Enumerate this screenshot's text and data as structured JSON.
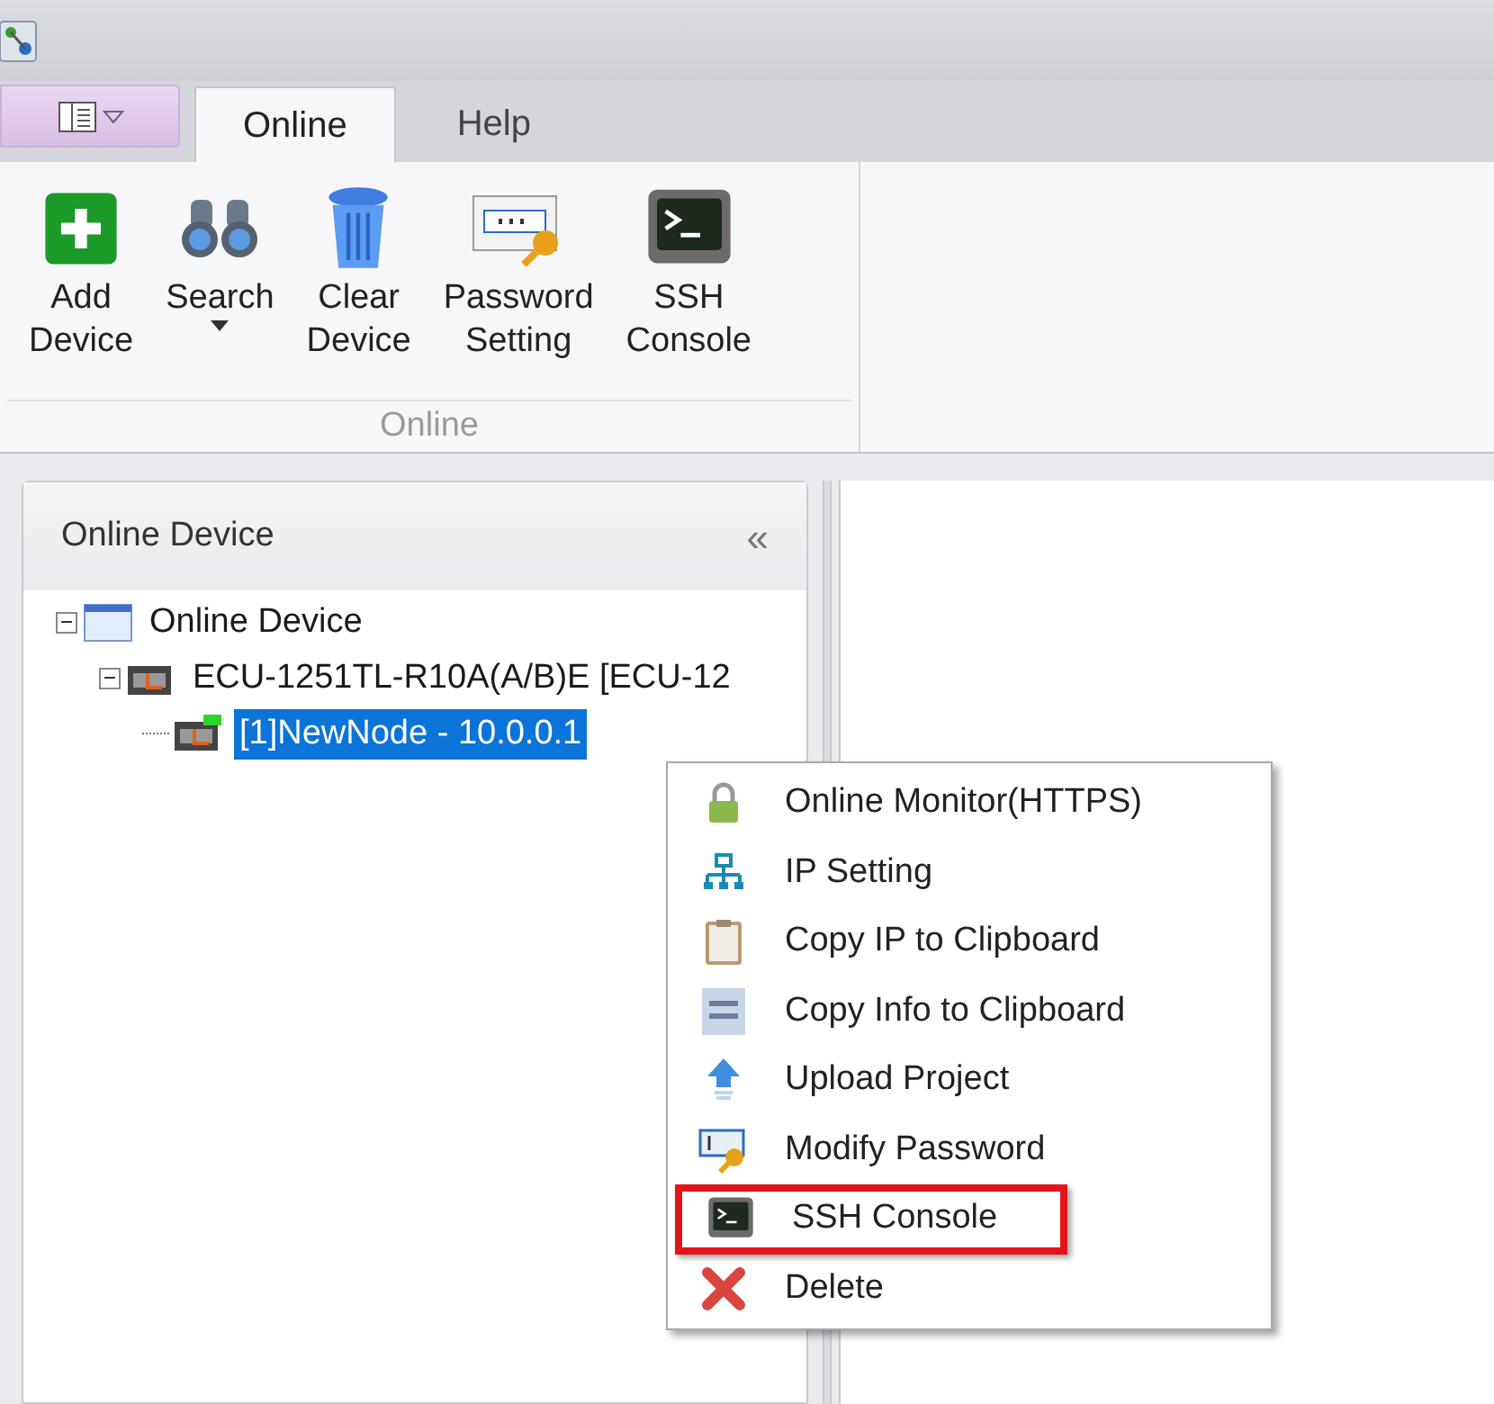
{
  "tabs": [
    {
      "label": "Online",
      "selected": true
    },
    {
      "label": "Help",
      "selected": false
    }
  ],
  "ribbon": {
    "group_label": "Online",
    "buttons": [
      {
        "lines": [
          "Add",
          "Device"
        ],
        "dropdown": false
      },
      {
        "lines": [
          "Search"
        ],
        "dropdown": true
      },
      {
        "lines": [
          "Clear",
          "Device"
        ],
        "dropdown": false
      },
      {
        "lines": [
          "Password",
          "Setting"
        ],
        "dropdown": false
      },
      {
        "lines": [
          "SSH",
          "Console"
        ],
        "dropdown": false
      }
    ]
  },
  "panel": {
    "title": "Online Device",
    "collapse_glyph": "«"
  },
  "tree": [
    {
      "label": "Online Device",
      "expanded": true,
      "selected": false,
      "children": [
        {
          "label": "ECU-1251TL-R10A(A/B)E [ECU-12",
          "expanded": true,
          "selected": false,
          "children": [
            {
              "label": "[1]NewNode - 10.0.0.1",
              "selected": true,
              "online": true
            }
          ]
        }
      ]
    }
  ],
  "context_menu": [
    {
      "label": "Online Monitor(HTTPS)",
      "highlighted": false
    },
    {
      "label": "IP Setting",
      "highlighted": false
    },
    {
      "label": "Copy IP to Clipboard",
      "highlighted": false
    },
    {
      "label": "Copy Info to Clipboard",
      "highlighted": false
    },
    {
      "label": "Upload Project",
      "highlighted": false
    },
    {
      "label": "Modify Password",
      "highlighted": false
    },
    {
      "label": "SSH Console",
      "highlighted": true
    },
    {
      "label": "Delete",
      "highlighted": false
    }
  ]
}
